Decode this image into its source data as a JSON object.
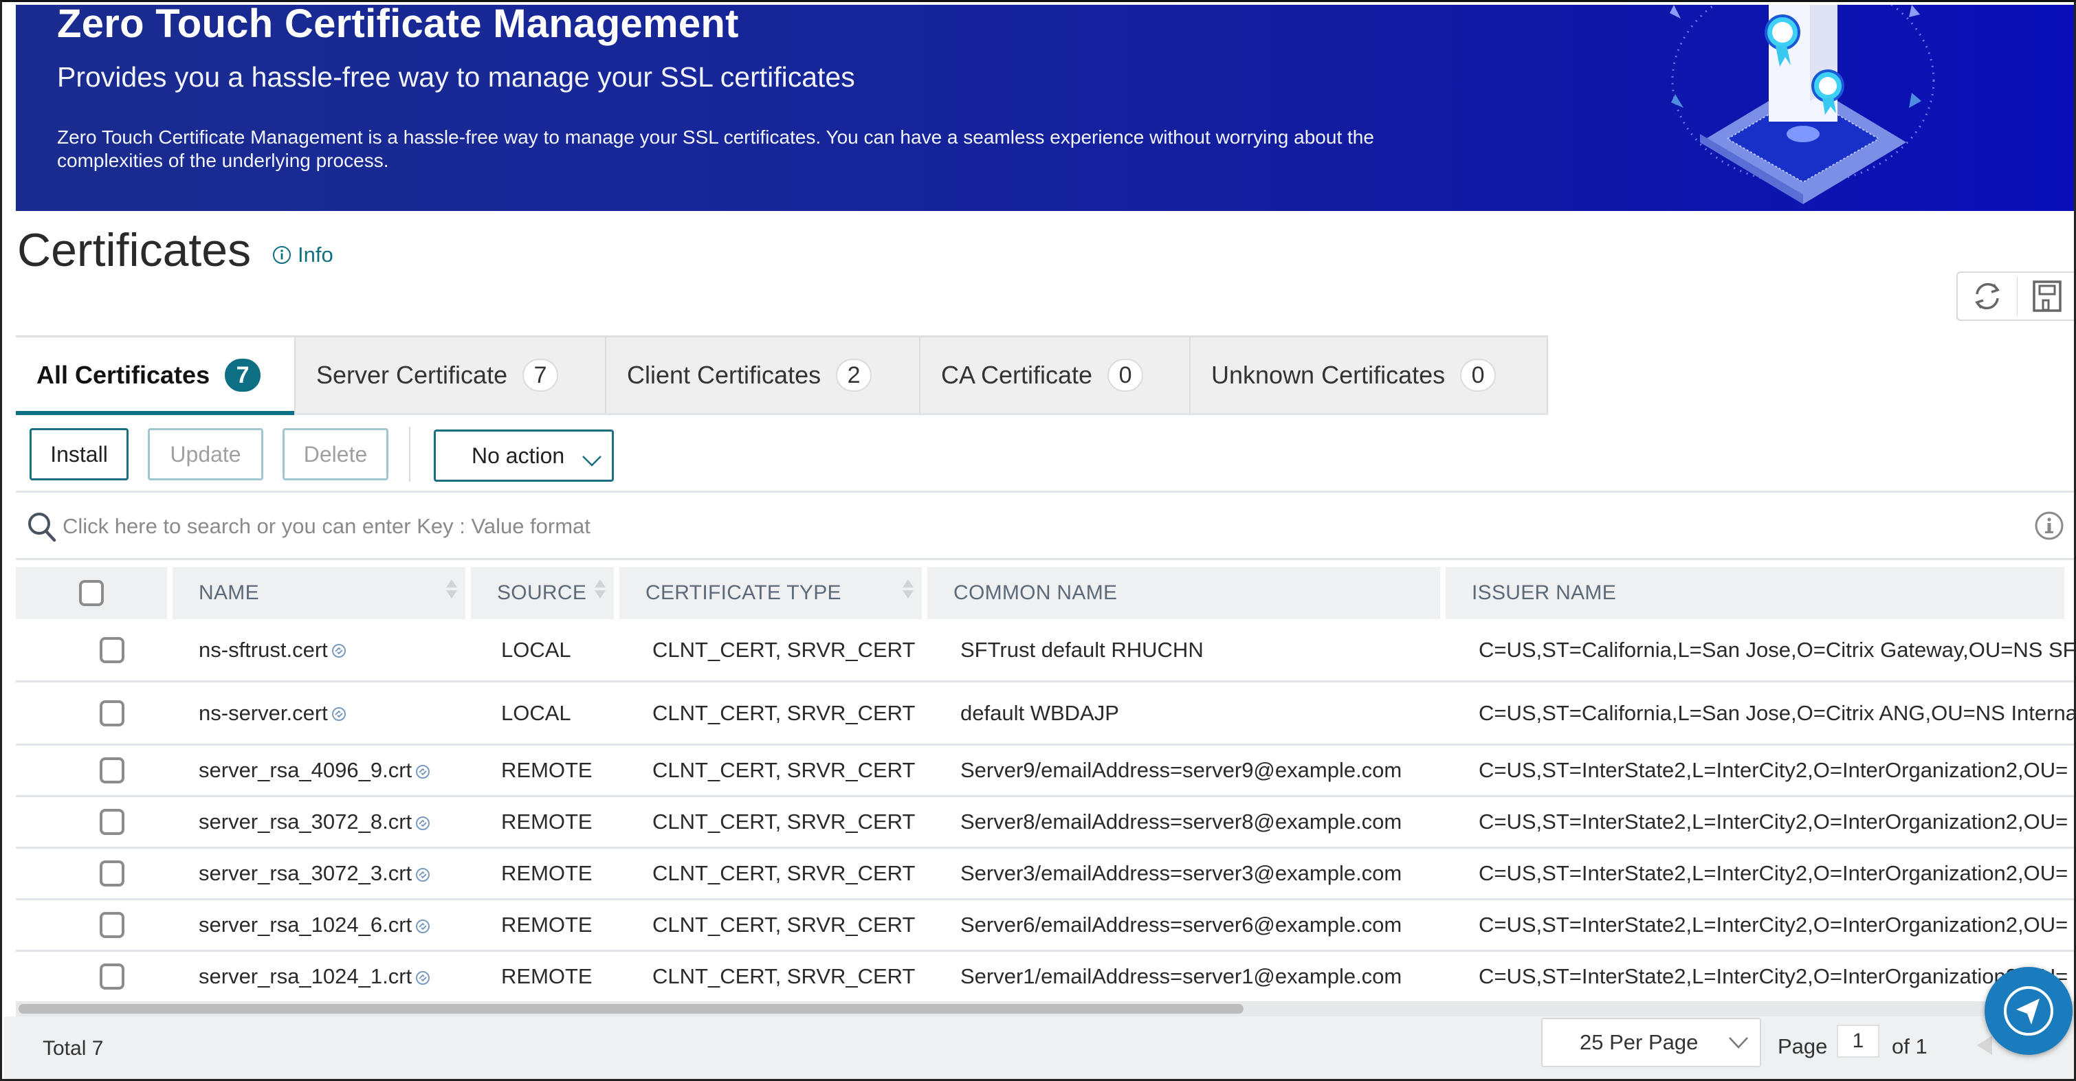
{
  "banner": {
    "title": "Zero Touch Certificate Management",
    "subtitle": "Provides you a hassle-free way to manage your SSL certificates",
    "description": "Zero Touch Certificate Management is a hassle-free way to manage your SSL certificates. You can have a seamless experience without worrying about the complexities of the underlying process.",
    "illustration": "certificate-pedestal-illustration"
  },
  "page": {
    "title": "Certificates",
    "info_label": "Info"
  },
  "toolbar_icons": [
    "refresh-icon",
    "save-icon"
  ],
  "tabs": [
    {
      "label": "All Certificates",
      "count": "7",
      "active": true
    },
    {
      "label": "Server Certificate",
      "count": "7",
      "active": false
    },
    {
      "label": "Client Certificates",
      "count": "2",
      "active": false
    },
    {
      "label": "CA Certificate",
      "count": "0",
      "active": false
    },
    {
      "label": "Unknown Certificates",
      "count": "0",
      "active": false
    }
  ],
  "actions": {
    "install": "Install",
    "update": "Update",
    "delete": "Delete",
    "select_value": "No action"
  },
  "search": {
    "placeholder": "Click here to search or you can enter Key : Value format"
  },
  "table": {
    "columns": [
      "NAME",
      "SOURCE",
      "CERTIFICATE TYPE",
      "COMMON NAME",
      "ISSUER NAME"
    ],
    "rows": [
      {
        "name": "ns-sftrust.cert",
        "source": "LOCAL",
        "type": "CLNT_CERT, SRVR_CERT",
        "common_name": "SFTrust default RHUCHN",
        "issuer": "C=US,ST=California,L=San Jose,O=Citrix Gateway,OU=NS SF"
      },
      {
        "name": "ns-server.cert",
        "source": "LOCAL",
        "type": "CLNT_CERT, SRVR_CERT",
        "common_name": "default WBDAJP",
        "issuer": "C=US,ST=California,L=San Jose,O=Citrix ANG,OU=NS Interna"
      },
      {
        "name": "server_rsa_4096_9.crt",
        "source": "REMOTE",
        "type": "CLNT_CERT, SRVR_CERT",
        "common_name": "Server9/emailAddress=server9@example.com",
        "issuer": "C=US,ST=InterState2,L=InterCity2,O=InterOrganization2,OU="
      },
      {
        "name": "server_rsa_3072_8.crt",
        "source": "REMOTE",
        "type": "CLNT_CERT, SRVR_CERT",
        "common_name": "Server8/emailAddress=server8@example.com",
        "issuer": "C=US,ST=InterState2,L=InterCity2,O=InterOrganization2,OU="
      },
      {
        "name": "server_rsa_3072_3.crt",
        "source": "REMOTE",
        "type": "CLNT_CERT, SRVR_CERT",
        "common_name": "Server3/emailAddress=server3@example.com",
        "issuer": "C=US,ST=InterState2,L=InterCity2,O=InterOrganization2,OU="
      },
      {
        "name": "server_rsa_1024_6.crt",
        "source": "REMOTE",
        "type": "CLNT_CERT, SRVR_CERT",
        "common_name": "Server6/emailAddress=server6@example.com",
        "issuer": "C=US,ST=InterState2,L=InterCity2,O=InterOrganization2,OU="
      },
      {
        "name": "server_rsa_1024_1.crt",
        "source": "REMOTE",
        "type": "CLNT_CERT, SRVR_CERT",
        "common_name": "Server1/emailAddress=server1@example.com",
        "issuer": "C=US,ST=InterState2,L=InterCity2,O=InterOrganization2,OU="
      }
    ]
  },
  "footer": {
    "total": "Total 7",
    "per_page": "25 Per Page",
    "page_label": "Page",
    "page_value": "1",
    "page_of": "of 1"
  },
  "colors": {
    "accent": "#0d6f83",
    "banner": "#1a2c8f",
    "fab": "#1a7bbd"
  }
}
